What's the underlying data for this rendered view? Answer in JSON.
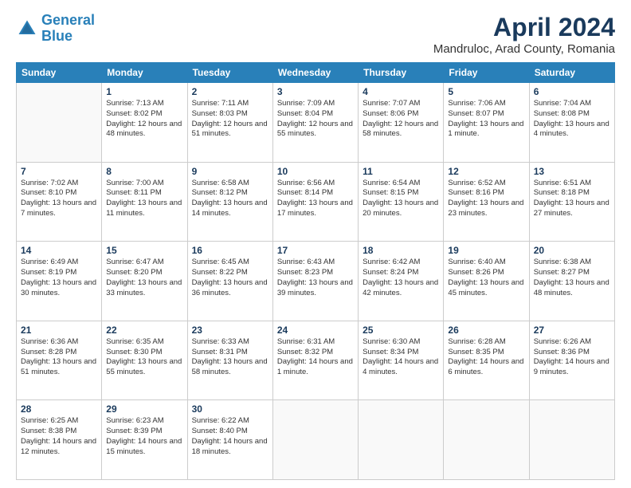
{
  "logo": {
    "line1": "General",
    "line2": "Blue"
  },
  "title": "April 2024",
  "subtitle": "Mandruloc, Arad County, Romania",
  "weekdays": [
    "Sunday",
    "Monday",
    "Tuesday",
    "Wednesday",
    "Thursday",
    "Friday",
    "Saturday"
  ],
  "weeks": [
    [
      {
        "day": null
      },
      {
        "day": "1",
        "sunrise": "Sunrise: 7:13 AM",
        "sunset": "Sunset: 8:02 PM",
        "daylight": "Daylight: 12 hours and 48 minutes."
      },
      {
        "day": "2",
        "sunrise": "Sunrise: 7:11 AM",
        "sunset": "Sunset: 8:03 PM",
        "daylight": "Daylight: 12 hours and 51 minutes."
      },
      {
        "day": "3",
        "sunrise": "Sunrise: 7:09 AM",
        "sunset": "Sunset: 8:04 PM",
        "daylight": "Daylight: 12 hours and 55 minutes."
      },
      {
        "day": "4",
        "sunrise": "Sunrise: 7:07 AM",
        "sunset": "Sunset: 8:06 PM",
        "daylight": "Daylight: 12 hours and 58 minutes."
      },
      {
        "day": "5",
        "sunrise": "Sunrise: 7:06 AM",
        "sunset": "Sunset: 8:07 PM",
        "daylight": "Daylight: 13 hours and 1 minute."
      },
      {
        "day": "6",
        "sunrise": "Sunrise: 7:04 AM",
        "sunset": "Sunset: 8:08 PM",
        "daylight": "Daylight: 13 hours and 4 minutes."
      }
    ],
    [
      {
        "day": "7",
        "sunrise": "Sunrise: 7:02 AM",
        "sunset": "Sunset: 8:10 PM",
        "daylight": "Daylight: 13 hours and 7 minutes."
      },
      {
        "day": "8",
        "sunrise": "Sunrise: 7:00 AM",
        "sunset": "Sunset: 8:11 PM",
        "daylight": "Daylight: 13 hours and 11 minutes."
      },
      {
        "day": "9",
        "sunrise": "Sunrise: 6:58 AM",
        "sunset": "Sunset: 8:12 PM",
        "daylight": "Daylight: 13 hours and 14 minutes."
      },
      {
        "day": "10",
        "sunrise": "Sunrise: 6:56 AM",
        "sunset": "Sunset: 8:14 PM",
        "daylight": "Daylight: 13 hours and 17 minutes."
      },
      {
        "day": "11",
        "sunrise": "Sunrise: 6:54 AM",
        "sunset": "Sunset: 8:15 PM",
        "daylight": "Daylight: 13 hours and 20 minutes."
      },
      {
        "day": "12",
        "sunrise": "Sunrise: 6:52 AM",
        "sunset": "Sunset: 8:16 PM",
        "daylight": "Daylight: 13 hours and 23 minutes."
      },
      {
        "day": "13",
        "sunrise": "Sunrise: 6:51 AM",
        "sunset": "Sunset: 8:18 PM",
        "daylight": "Daylight: 13 hours and 27 minutes."
      }
    ],
    [
      {
        "day": "14",
        "sunrise": "Sunrise: 6:49 AM",
        "sunset": "Sunset: 8:19 PM",
        "daylight": "Daylight: 13 hours and 30 minutes."
      },
      {
        "day": "15",
        "sunrise": "Sunrise: 6:47 AM",
        "sunset": "Sunset: 8:20 PM",
        "daylight": "Daylight: 13 hours and 33 minutes."
      },
      {
        "day": "16",
        "sunrise": "Sunrise: 6:45 AM",
        "sunset": "Sunset: 8:22 PM",
        "daylight": "Daylight: 13 hours and 36 minutes."
      },
      {
        "day": "17",
        "sunrise": "Sunrise: 6:43 AM",
        "sunset": "Sunset: 8:23 PM",
        "daylight": "Daylight: 13 hours and 39 minutes."
      },
      {
        "day": "18",
        "sunrise": "Sunrise: 6:42 AM",
        "sunset": "Sunset: 8:24 PM",
        "daylight": "Daylight: 13 hours and 42 minutes."
      },
      {
        "day": "19",
        "sunrise": "Sunrise: 6:40 AM",
        "sunset": "Sunset: 8:26 PM",
        "daylight": "Daylight: 13 hours and 45 minutes."
      },
      {
        "day": "20",
        "sunrise": "Sunrise: 6:38 AM",
        "sunset": "Sunset: 8:27 PM",
        "daylight": "Daylight: 13 hours and 48 minutes."
      }
    ],
    [
      {
        "day": "21",
        "sunrise": "Sunrise: 6:36 AM",
        "sunset": "Sunset: 8:28 PM",
        "daylight": "Daylight: 13 hours and 51 minutes."
      },
      {
        "day": "22",
        "sunrise": "Sunrise: 6:35 AM",
        "sunset": "Sunset: 8:30 PM",
        "daylight": "Daylight: 13 hours and 55 minutes."
      },
      {
        "day": "23",
        "sunrise": "Sunrise: 6:33 AM",
        "sunset": "Sunset: 8:31 PM",
        "daylight": "Daylight: 13 hours and 58 minutes."
      },
      {
        "day": "24",
        "sunrise": "Sunrise: 6:31 AM",
        "sunset": "Sunset: 8:32 PM",
        "daylight": "Daylight: 14 hours and 1 minute."
      },
      {
        "day": "25",
        "sunrise": "Sunrise: 6:30 AM",
        "sunset": "Sunset: 8:34 PM",
        "daylight": "Daylight: 14 hours and 4 minutes."
      },
      {
        "day": "26",
        "sunrise": "Sunrise: 6:28 AM",
        "sunset": "Sunset: 8:35 PM",
        "daylight": "Daylight: 14 hours and 6 minutes."
      },
      {
        "day": "27",
        "sunrise": "Sunrise: 6:26 AM",
        "sunset": "Sunset: 8:36 PM",
        "daylight": "Daylight: 14 hours and 9 minutes."
      }
    ],
    [
      {
        "day": "28",
        "sunrise": "Sunrise: 6:25 AM",
        "sunset": "Sunset: 8:38 PM",
        "daylight": "Daylight: 14 hours and 12 minutes."
      },
      {
        "day": "29",
        "sunrise": "Sunrise: 6:23 AM",
        "sunset": "Sunset: 8:39 PM",
        "daylight": "Daylight: 14 hours and 15 minutes."
      },
      {
        "day": "30",
        "sunrise": "Sunrise: 6:22 AM",
        "sunset": "Sunset: 8:40 PM",
        "daylight": "Daylight: 14 hours and 18 minutes."
      },
      {
        "day": null
      },
      {
        "day": null
      },
      {
        "day": null
      },
      {
        "day": null
      }
    ]
  ]
}
